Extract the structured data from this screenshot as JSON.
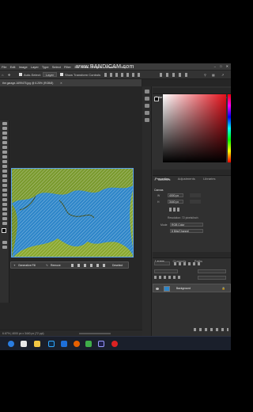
{
  "app": {
    "watermark": "www.BANDICAM.com",
    "menus": [
      "File",
      "Edit",
      "Image",
      "Layer",
      "Type",
      "Select",
      "Filter",
      "3D",
      "View",
      "Plugins",
      "Window",
      "Help"
    ]
  },
  "options_bar": {
    "auto_select_label": "Auto-Select:",
    "auto_select_value": "Layer",
    "show_transform_label": "Show Transform Controls"
  },
  "document": {
    "tab_title": "the garage-1699475.jpg @ 6.25% (RGB/8)",
    "status_text": "6.67% | 4000 px x 3440 px (72 ppi)"
  },
  "contextual_taskbar": {
    "generative_fill_label": "Generative Fill",
    "remove_label": "Remove",
    "deselect_label": "Deselect"
  },
  "color_panel": {
    "tabs": [
      "Color",
      "Swatches",
      "Gradients",
      "Patterns"
    ]
  },
  "properties_panel": {
    "tabs": [
      "Properties",
      "Adjustments",
      "Libraries"
    ],
    "section_label": "Document",
    "canvas_label": "Canvas",
    "width_value": "4000 px",
    "height_value": "3440 px",
    "resolution_text": "Resolution: 72 pixels/inch",
    "mode_label": "Mode",
    "mode_value": "RGB Color",
    "bit_value": "8 Bits/Channel"
  },
  "layers_panel": {
    "tabs": [
      "Layers",
      "Channels",
      "Paths"
    ],
    "layers": [
      {
        "name": "Background"
      }
    ]
  },
  "colors": {
    "accent": "#2e86c9",
    "panel": "#303030",
    "taskbar": "#1a1f2b"
  }
}
